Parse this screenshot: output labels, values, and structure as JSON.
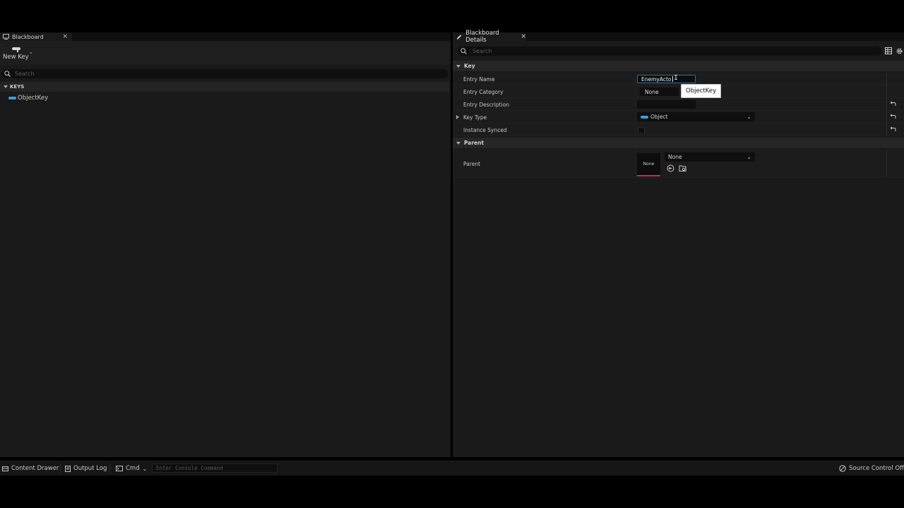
{
  "blackboard_tab": {
    "title": "Blackboard",
    "close": "×"
  },
  "toolbar": {
    "new_key_label": "New Key"
  },
  "left_search": {
    "placeholder": "Search"
  },
  "keys": {
    "header": "KEYS",
    "items": [
      {
        "label": "ObjectKey",
        "type_color": "#3aa1d8"
      }
    ]
  },
  "details_tab": {
    "title": "Blackboard Details",
    "close": "×"
  },
  "details_search": {
    "placeholder": "Search"
  },
  "key_section": {
    "header": "Key",
    "entry_name_label": "Entry Name",
    "entry_name_value": "EnemyActo",
    "entry_name_tooltip": "ObjectKey",
    "entry_category_label": "Entry Category",
    "entry_category_value": "None",
    "entry_description_label": "Entry Description",
    "entry_description_value": "",
    "key_type_label": "Key Type",
    "key_type_value": "Object",
    "instance_synced_label": "Instance Synced",
    "instance_synced_checked": false
  },
  "parent_section": {
    "header": "Parent",
    "parent_label": "Parent",
    "thumbnail_text": "None",
    "parent_value": "None",
    "thumbnail_border_color": "#c02a5a"
  },
  "statusbar": {
    "content_drawer": "Content Drawer",
    "output_log": "Output Log",
    "cmd": "Cmd",
    "console_placeholder": "Enter Console Command",
    "source_control": "Source Control Off"
  },
  "colors": {
    "accent": "#2e6da4",
    "object_type": "#3aa1d8",
    "panel_bg": "#1a1a1a"
  }
}
